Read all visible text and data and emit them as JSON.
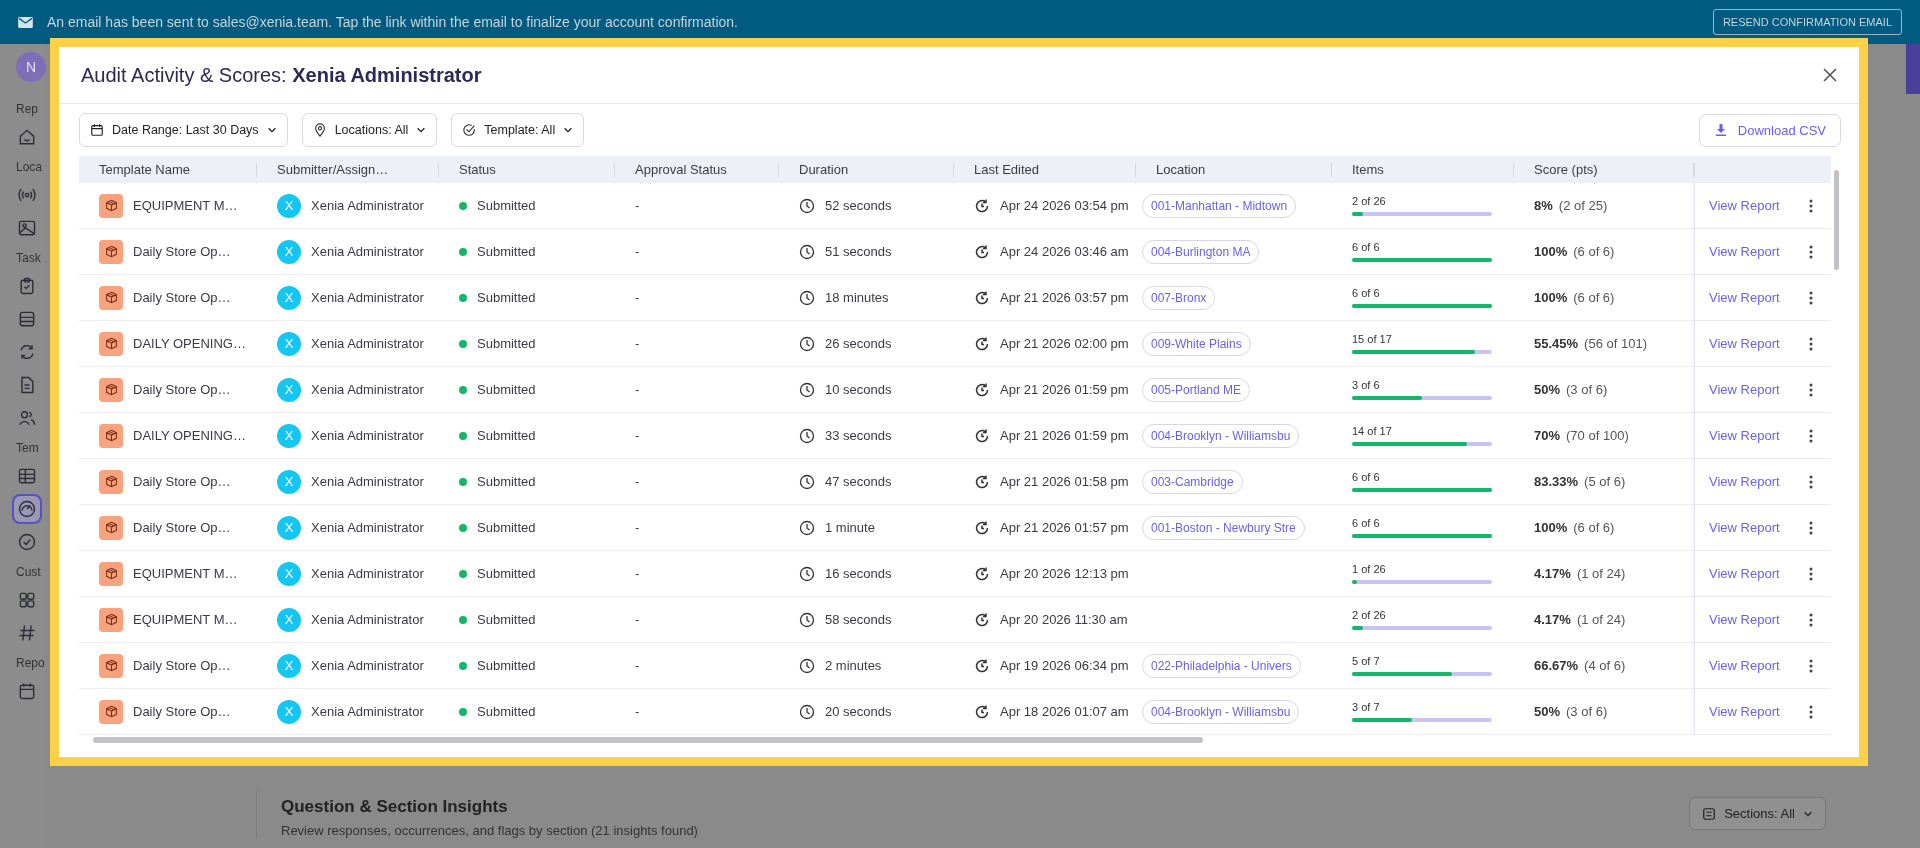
{
  "banner": {
    "message": "An email has been sent to sales@xenia.team. Tap the link within the email to finalize your account confirmation.",
    "button": "RESEND CONFIRMATION EMAIL"
  },
  "sidebar": {
    "avatar": "N",
    "sections": [
      {
        "label": "Rep",
        "items": [
          {
            "selected": false
          }
        ]
      },
      {
        "label": "Loca",
        "items": [
          {
            "selected": false
          },
          {
            "selected": false
          }
        ]
      },
      {
        "label": "Task",
        "items": [
          {
            "selected": false
          },
          {
            "selected": false
          },
          {
            "selected": false
          },
          {
            "selected": false
          },
          {
            "selected": false
          }
        ]
      },
      {
        "label": "Tem",
        "items": [
          {
            "selected": false
          },
          {
            "selected": true
          },
          {
            "selected": false
          }
        ]
      },
      {
        "label": "Cust",
        "items": [
          {
            "selected": false
          },
          {
            "selected": false
          }
        ]
      },
      {
        "label": "Repo",
        "items": [
          {
            "selected": false
          }
        ]
      }
    ]
  },
  "background_section": {
    "title": "Question & Section Insights",
    "subtitle": "Review responses, occurrences, and flags by section (21 insights found)",
    "filter": "Sections: All"
  },
  "modal": {
    "title": "Audit Activity & Scores: **Xenia Administrator**",
    "filters": [
      "Date Range: Last 30 Days",
      "Locations: All",
      "Template: All"
    ],
    "download": "Download CSV",
    "columns": [
      "Template Name",
      "Submitter/Assign…",
      "Status",
      "Approval Status",
      "Duration",
      "Last Edited",
      "Location",
      "Items",
      "Score (pts)"
    ],
    "rows": [
      {
        "template": "EQUIPMENT M…",
        "avatar": "X",
        "submitter": "Xenia Administrator",
        "status": "Submitted",
        "approval": "-",
        "duration": "52 seconds",
        "edited": "Apr 24 2026 03:54 pm",
        "location": "001-Manhattan - Midtown",
        "items": "2 of 26",
        "level": 0.077,
        "score": "8%",
        "score_detail": "(2 of 25)",
        "action": "View Report"
      },
      {
        "template": "Daily Store Op…",
        "avatar": "X",
        "submitter": "Xenia Administrator",
        "status": "Submitted",
        "approval": "-",
        "duration": "51 seconds",
        "edited": "Apr 24 2026 03:46 am",
        "location": "004-Burlington MA",
        "items": "6 of 6",
        "level": 1,
        "score": "100%",
        "score_detail": "(6 of 6)",
        "action": "View Report"
      },
      {
        "template": "Daily Store Op…",
        "avatar": "X",
        "submitter": "Xenia Administrator",
        "status": "Submitted",
        "approval": "-",
        "duration": "18 minutes",
        "edited": "Apr 21 2026 03:57 pm",
        "location": "007-Bronx",
        "items": "6 of 6",
        "level": 1,
        "score": "100%",
        "score_detail": "(6 of 6)",
        "action": "View Report"
      },
      {
        "template": "DAILY OPENING…",
        "avatar": "X",
        "submitter": "Xenia Administrator",
        "status": "Submitted",
        "approval": "-",
        "duration": "26 seconds",
        "edited": "Apr 21 2026 02:00 pm",
        "location": "009-White Plains",
        "items": "15 of 17",
        "level": 0.882,
        "score": "55.45%",
        "score_detail": "(56 of 101)",
        "action": "View Report"
      },
      {
        "template": "Daily Store Op…",
        "avatar": "X",
        "submitter": "Xenia Administrator",
        "status": "Submitted",
        "approval": "-",
        "duration": "10 seconds",
        "edited": "Apr 21 2026 01:59 pm",
        "location": "005-Portland ME",
        "items": "3 of 6",
        "level": 0.5,
        "score": "50%",
        "score_detail": "(3 of 6)",
        "action": "View Report"
      },
      {
        "template": "DAILY OPENING…",
        "avatar": "X",
        "submitter": "Xenia Administrator",
        "status": "Submitted",
        "approval": "-",
        "duration": "33 seconds",
        "edited": "Apr 21 2026 01:59 pm",
        "location": "004-Brooklyn - Williamsbu",
        "items": "14 of 17",
        "level": 0.824,
        "score": "70%",
        "score_detail": "(70 of 100)",
        "action": "View Report"
      },
      {
        "template": "Daily Store Op…",
        "avatar": "X",
        "submitter": "Xenia Administrator",
        "status": "Submitted",
        "approval": "-",
        "duration": "47 seconds",
        "edited": "Apr 21 2026 01:58 pm",
        "location": "003-Cambridge",
        "items": "6 of 6",
        "level": 1,
        "score": "83.33%",
        "score_detail": "(5 of 6)",
        "action": "View Report"
      },
      {
        "template": "Daily Store Op…",
        "avatar": "X",
        "submitter": "Xenia Administrator",
        "status": "Submitted",
        "approval": "-",
        "duration": "1 minute",
        "edited": "Apr 21 2026 01:57 pm",
        "location": "001-Boston - Newbury Stre",
        "items": "6 of 6",
        "level": 1,
        "score": "100%",
        "score_detail": "(6 of 6)",
        "action": "View Report"
      },
      {
        "template": "EQUIPMENT M…",
        "avatar": "X",
        "submitter": "Xenia Administrator",
        "status": "Submitted",
        "approval": "-",
        "duration": "16 seconds",
        "edited": "Apr 20 2026 12:13 pm",
        "items": "1 of 26",
        "level": 0.038,
        "score": "4.17%",
        "score_detail": "(1 of 24)",
        "action": "View Report"
      },
      {
        "template": "EQUIPMENT M…",
        "avatar": "X",
        "submitter": "Xenia Administrator",
        "status": "Submitted",
        "approval": "-",
        "duration": "58 seconds",
        "edited": "Apr 20 2026 11:30 am",
        "items": "2 of 26",
        "level": 0.077,
        "score": "4.17%",
        "score_detail": "(1 of 24)",
        "action": "View Report"
      },
      {
        "template": "Daily Store Op…",
        "avatar": "X",
        "submitter": "Xenia Administrator",
        "status": "Submitted",
        "approval": "-",
        "duration": "2 minutes",
        "edited": "Apr 19 2026 06:34 pm",
        "location": "022-Philadelphia - Univers",
        "items": "5 of 7",
        "level": 0.714,
        "score": "66.67%",
        "score_detail": "(4 of 6)",
        "action": "View Report"
      },
      {
        "template": "Daily Store Op…",
        "avatar": "X",
        "submitter": "Xenia Administrator",
        "status": "Submitted",
        "approval": "-",
        "duration": "20 seconds",
        "edited": "Apr 18 2026 01:07 am",
        "location": "004-Brooklyn - Williamsbu",
        "items": "3 of 7",
        "level": 0.429,
        "score": "50%",
        "score_detail": "(3 of 6)",
        "action": "View Report"
      }
    ]
  }
}
